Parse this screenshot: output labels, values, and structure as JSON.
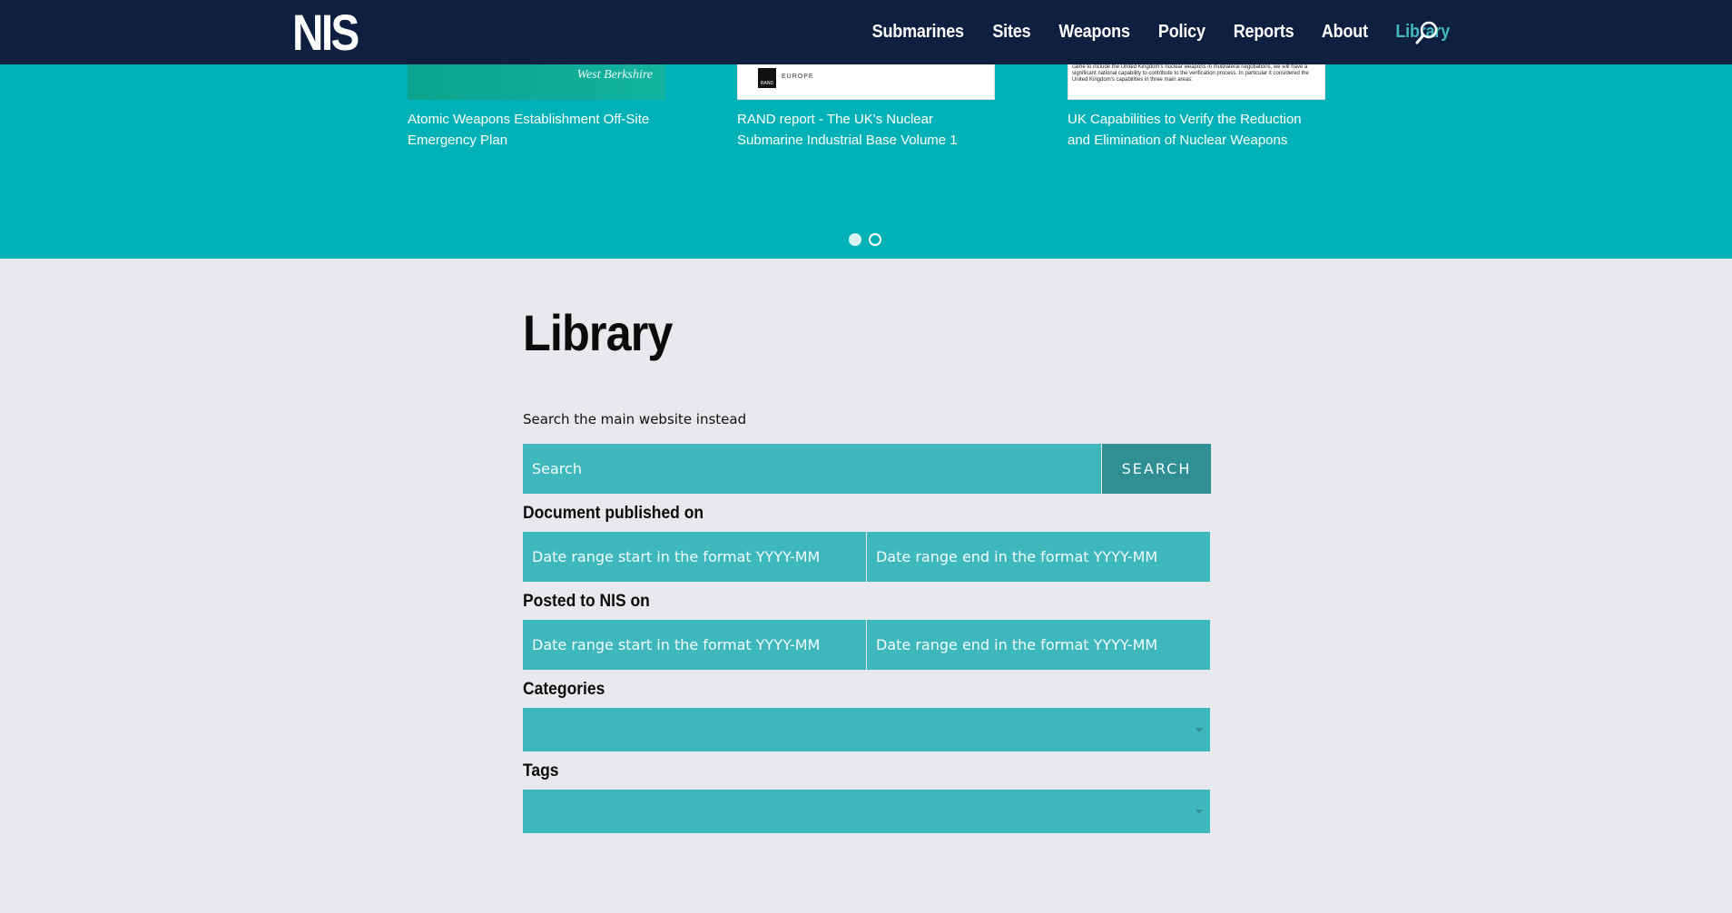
{
  "header": {
    "logo": "NIS",
    "nav": [
      {
        "label": "Submarines"
      },
      {
        "label": "Sites"
      },
      {
        "label": "Weapons"
      },
      {
        "label": "Policy"
      },
      {
        "label": "Reports"
      },
      {
        "label": "About"
      },
      {
        "label": "Library",
        "active": true
      }
    ],
    "search_icon": "search-icon"
  },
  "carousel": {
    "slides": [
      {
        "caption": "Atomic Weapons Establishment Off-Site Emergency Plan",
        "thumb_text": "West Berkshire"
      },
      {
        "caption": "RAND report - The UK's Nuclear Submarine Industrial Base Volume 1",
        "thumb_text": "EUROPE",
        "logo_text": "RAND"
      },
      {
        "caption": "UK Capabilities to Verify the Reduction and Elimination of Nuclear Weapons",
        "thumb_text": "came to include the United Kingdom's nuclear weapons in multilateral negotiations, we will have a significant national capability to contribute to the verification process. In particular it considered the United Kingdom's capabilities in three main areas:"
      }
    ],
    "dots": [
      {
        "active": true
      },
      {
        "active": false
      }
    ]
  },
  "main": {
    "title": "Library",
    "search_main_link": "Search the main website instead",
    "search": {
      "placeholder": "Search",
      "button_label": "SEARCH"
    },
    "published": {
      "label": "Document published on",
      "start_placeholder": "Date range start in the format YYYY-MM",
      "end_placeholder": "Date range end in the format YYYY-MM"
    },
    "posted": {
      "label": "Posted to NIS on",
      "start_placeholder": "Date range start in the format YYYY-MM",
      "end_placeholder": "Date range end in the format YYYY-MM"
    },
    "categories": {
      "label": "Categories"
    },
    "tags": {
      "label": "Tags"
    }
  },
  "colors": {
    "header_bg": "#0f1f40",
    "accent_teal": "#00b2b8",
    "input_teal": "#3fb8bd",
    "button_teal": "#2f8f92",
    "nav_active": "#41b8bd",
    "page_bg": "#e8e9ec"
  }
}
